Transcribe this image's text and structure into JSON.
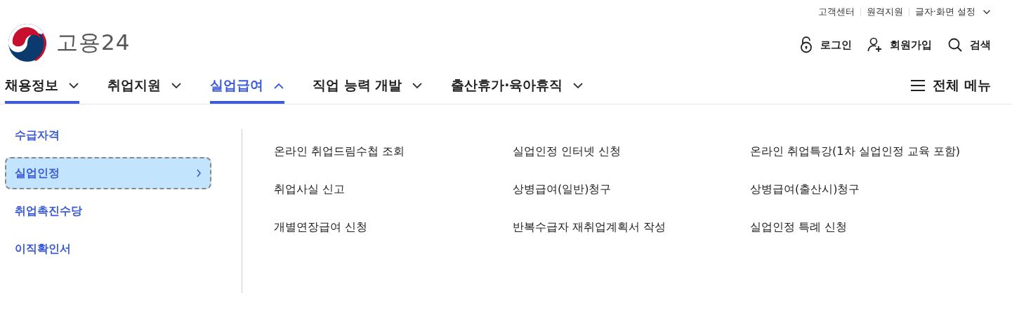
{
  "utility_links": [
    "고객센터",
    "원격지원",
    "글자·화면 설정"
  ],
  "logo": {
    "text": "고용24"
  },
  "account_actions": [
    {
      "kind": "login",
      "label": "로그인"
    },
    {
      "kind": "signup",
      "label": "회원가입"
    },
    {
      "kind": "search",
      "label": "검색"
    }
  ],
  "nav": {
    "tabs": [
      {
        "label": "채용정보",
        "selected": false,
        "underlined": true
      },
      {
        "label": "취업지원",
        "selected": false,
        "underlined": false
      },
      {
        "label": "실업급여",
        "selected": true,
        "underlined": true
      },
      {
        "label": "직업 능력 개발",
        "selected": false,
        "underlined": false
      },
      {
        "label": "출산휴가·육아휴직",
        "selected": false,
        "underlined": false
      }
    ],
    "all_menu": "전체 메뉴"
  },
  "submenu": {
    "items": [
      {
        "label": "수급자격",
        "selected": false
      },
      {
        "label": "실업인정",
        "selected": true
      },
      {
        "label": "취업촉진수당",
        "selected": false
      },
      {
        "label": "이직확인서",
        "selected": false
      }
    ],
    "links": [
      "온라인 취업드림수첩 조회",
      "실업인정 인터넷 신청",
      "온라인 취업특강(1차 실업인정 교육 포함)",
      "취업사실 신고",
      "상병급여(일반)청구",
      "상병급여(출산시)청구",
      "개별연장급여 신청",
      "반복수급자 재취업계획서 작성",
      "실업인정 특례 신청"
    ]
  }
}
